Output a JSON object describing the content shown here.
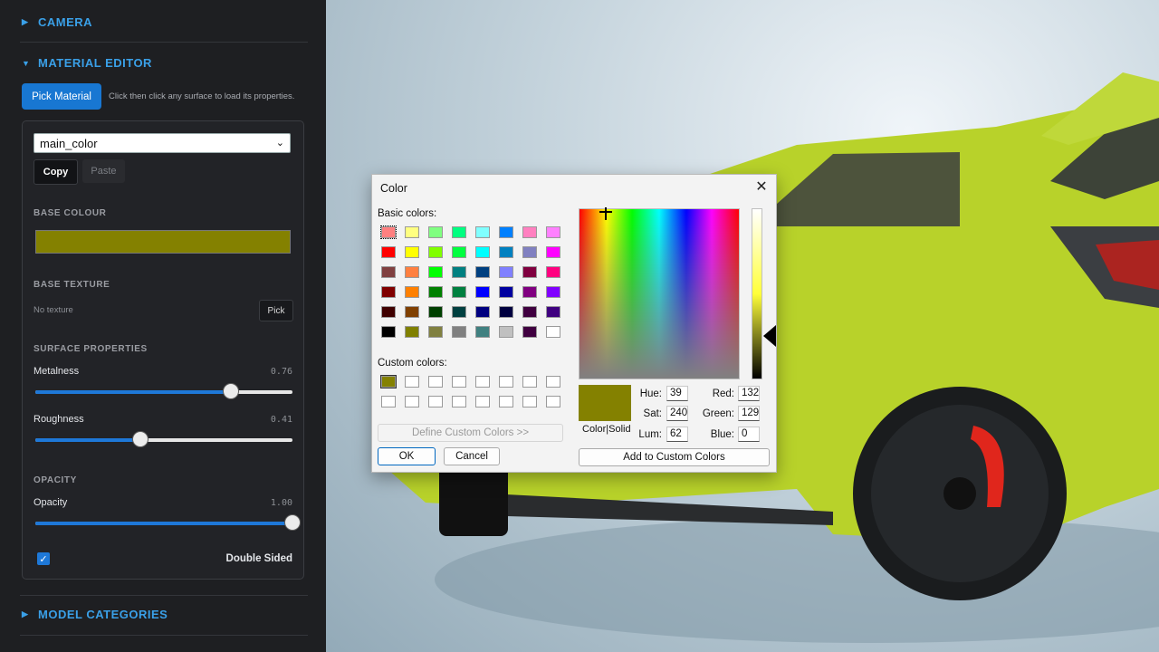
{
  "sidebar": {
    "camera_label": "CAMERA",
    "material_editor_label": "MATERIAL EDITOR",
    "pick_material_label": "Pick Material",
    "pick_hint": "Click then click any surface to load its properties.",
    "material_select_value": "main_color",
    "copy_label": "Copy",
    "paste_label": "Paste",
    "base_colour_label": "BASE COLOUR",
    "base_colour_value": "#848100",
    "base_texture_label": "BASE TEXTURE",
    "no_texture_label": "No texture",
    "texture_pick_label": "Pick",
    "surface_properties_label": "SURFACE PROPERTIES",
    "metalness_label": "Metalness",
    "metalness_value": "0.76",
    "roughness_label": "Roughness",
    "roughness_value": "0.41",
    "opacity_section_label": "OPACITY",
    "opacity_label": "Opacity",
    "opacity_value": "1.00",
    "double_sided_label": "Double Sided",
    "model_categories_label": "MODEL CATEGORIES"
  },
  "dialog": {
    "title": "Color",
    "basic_colors_label": "Basic colors:",
    "custom_colors_label": "Custom colors:",
    "define_custom_label": "Define Custom Colors >>",
    "ok_label": "OK",
    "cancel_label": "Cancel",
    "color_solid_label": "Color|Solid",
    "add_custom_label": "Add to Custom Colors",
    "hue_label": "Hue:",
    "hue_value": "39",
    "sat_label": "Sat:",
    "sat_value": "240",
    "lum_label": "Lum:",
    "lum_value": "62",
    "red_label": "Red:",
    "red_value": "132",
    "green_label": "Green:",
    "green_value": "129",
    "blue_label": "Blue:",
    "blue_value": "0",
    "basic_colors": [
      [
        "#ff8080",
        "#ffff80",
        "#80ff80",
        "#00ff80",
        "#80ffff",
        "#0080ff",
        "#ff80c0",
        "#ff80ff"
      ],
      [
        "#ff0000",
        "#ffff00",
        "#80ff00",
        "#00ff40",
        "#00ffff",
        "#0080c0",
        "#8080c0",
        "#ff00ff"
      ],
      [
        "#804040",
        "#ff8040",
        "#00ff00",
        "#008080",
        "#004080",
        "#8080ff",
        "#800040",
        "#ff0080"
      ],
      [
        "#800000",
        "#ff8000",
        "#008000",
        "#008040",
        "#0000ff",
        "#0000a0",
        "#800080",
        "#8000ff"
      ],
      [
        "#400000",
        "#804000",
        "#004000",
        "#004040",
        "#000080",
        "#000040",
        "#400040",
        "#400080"
      ],
      [
        "#000000",
        "#808000",
        "#808040",
        "#808080",
        "#408080",
        "#c0c0c0",
        "#400040",
        "#ffffff"
      ]
    ],
    "custom_colors": [
      [
        "#848100",
        "#ffffff",
        "#ffffff",
        "#ffffff",
        "#ffffff",
        "#ffffff",
        "#ffffff",
        "#ffffff"
      ],
      [
        "#ffffff",
        "#ffffff",
        "#ffffff",
        "#ffffff",
        "#ffffff",
        "#ffffff",
        "#ffffff",
        "#ffffff"
      ]
    ],
    "current_color": "#848100"
  },
  "controls": {
    "metalness": 0.76,
    "roughness": 0.41,
    "opacity": 1.0
  },
  "icons": {
    "collapsed_arrow": "caret-right-icon",
    "expanded_arrow": "caret-down-icon",
    "check": "checkmark-icon",
    "close": "close-icon"
  },
  "scene": {
    "car_color": "#b8d22a",
    "caliper_color": "#e0261c"
  }
}
